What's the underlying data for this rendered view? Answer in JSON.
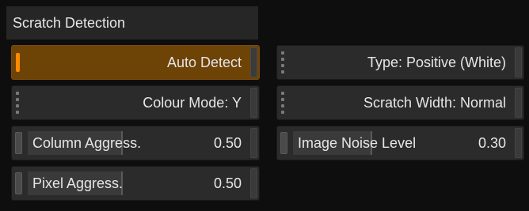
{
  "panel": {
    "title": "Scratch Detection"
  },
  "buttons": {
    "auto_detect": "Auto Detect",
    "type": "Type: Positive (White)",
    "colour_mode": "Colour Mode: Y",
    "scratch_width": "Scratch Width: Normal"
  },
  "sliders": {
    "column_aggress": {
      "label": "Column Aggress.",
      "value": "0.50",
      "level": 0.5
    },
    "image_noise": {
      "label": "Image Noise Level",
      "value": "0.30",
      "level": 0.3
    },
    "pixel_aggress": {
      "label": "Pixel Aggress.",
      "value": "0.50",
      "level": 0.5
    }
  },
  "colors": {
    "active_bg": "#6e4306",
    "active_indicator": "#ff8a00",
    "control_bg": "#2b2b2b",
    "panel_bg": "#0e0e0e"
  }
}
